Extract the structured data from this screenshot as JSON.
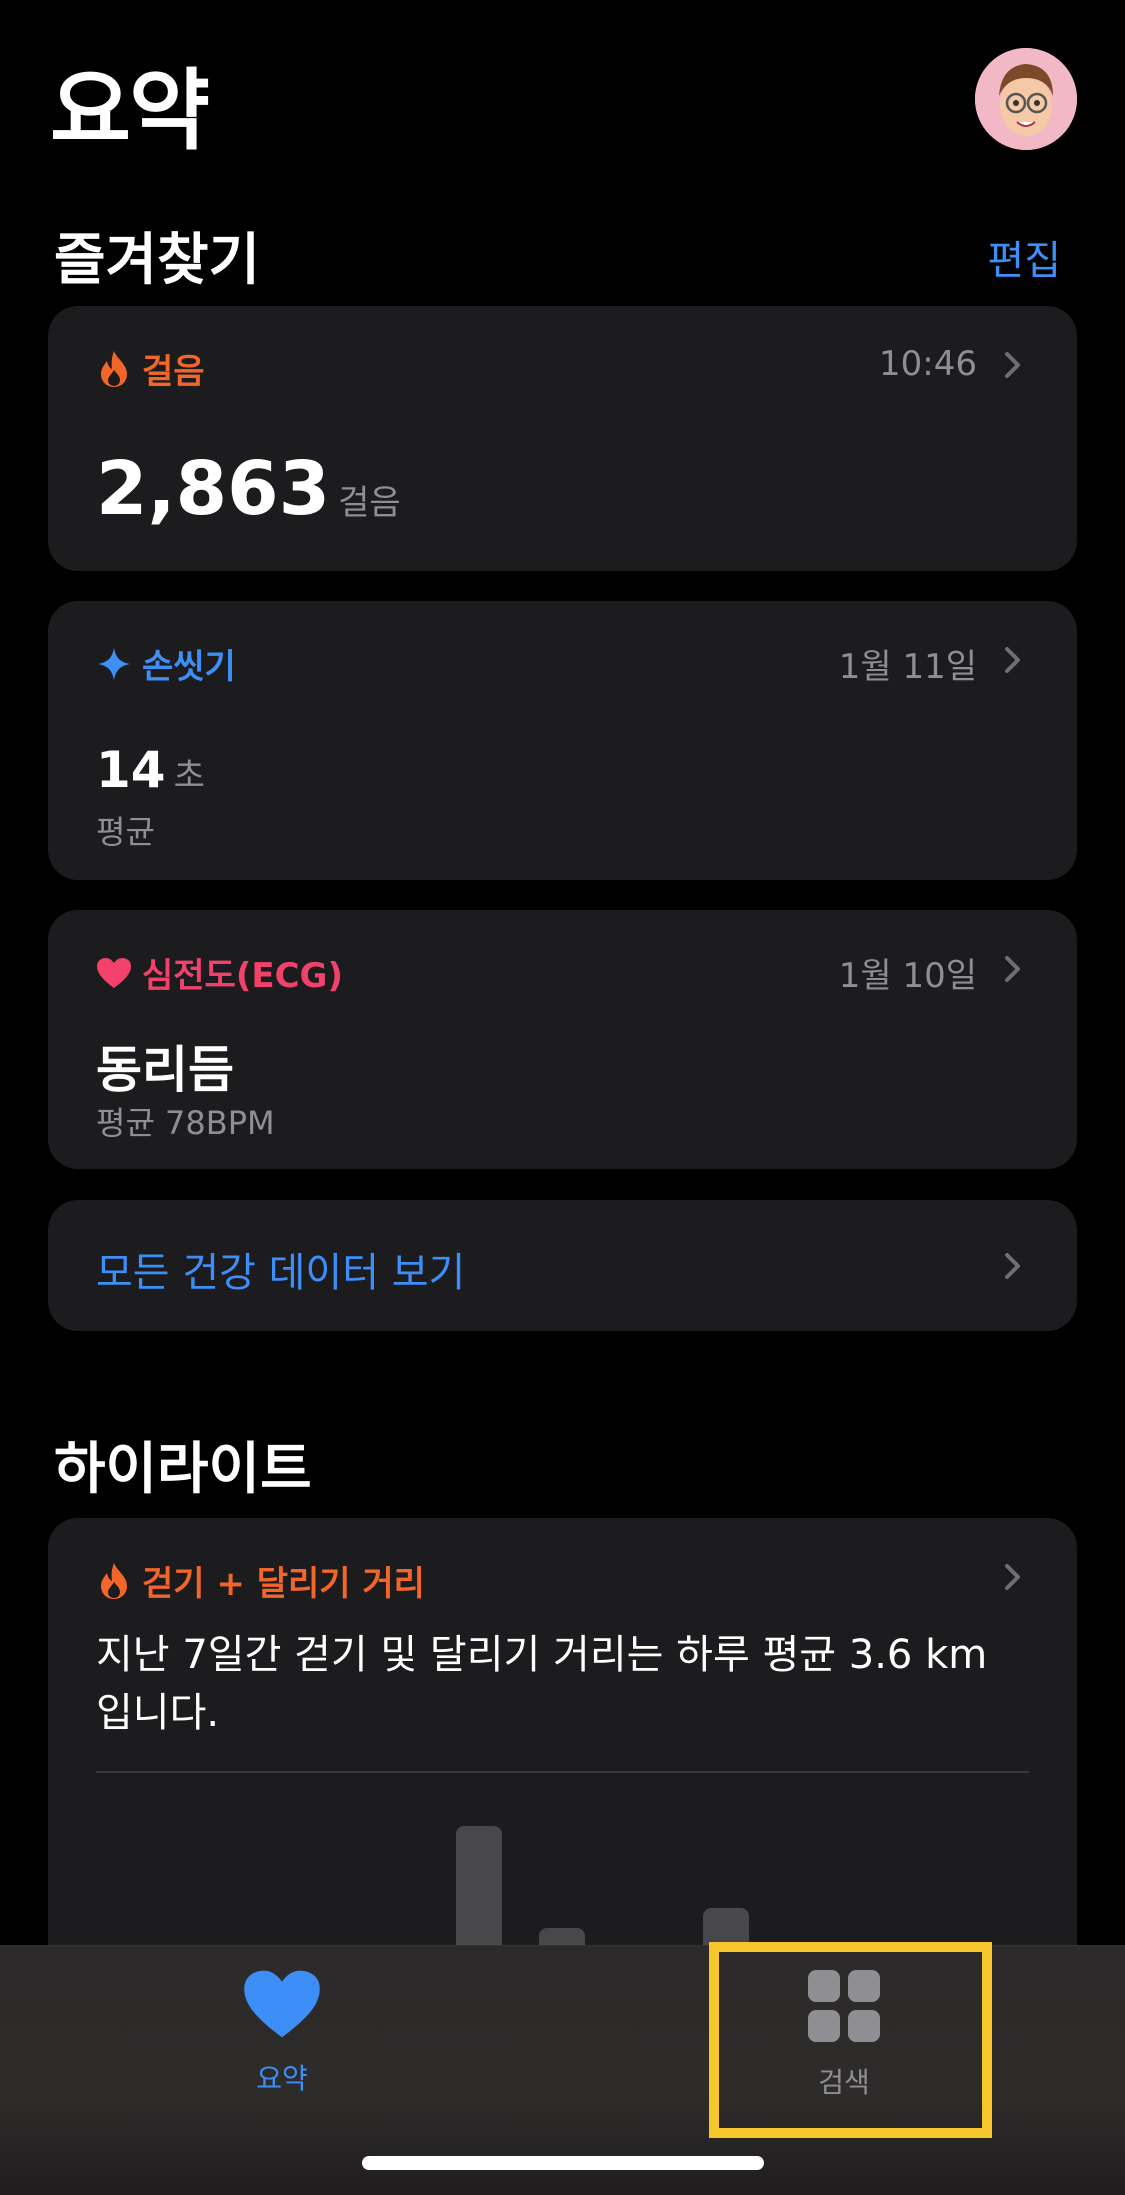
{
  "header": {
    "title": "요약"
  },
  "favorites": {
    "title": "즐겨찾기",
    "edit_label": "편집",
    "steps": {
      "label": "걸음",
      "time": "10:46",
      "value": "2,863",
      "unit": "걸음"
    },
    "handwash": {
      "label": "손씻기",
      "date": "1월 11일",
      "value": "14",
      "unit": "초",
      "sub": "평균"
    },
    "ecg": {
      "label": "심전도(ECG)",
      "date": "1월 10일",
      "value": "동리듬",
      "sub": "평균 78BPM"
    },
    "all_data_label": "모든 건강 데이터 보기"
  },
  "highlights": {
    "title": "하이라이트",
    "card": {
      "label": "걷기 + 달리기 거리",
      "text": "지난 7일간 걷기 및 달리기 거리는 하루 평균 3.6 km입니다."
    }
  },
  "tabbar": {
    "summary_label": "요약",
    "browse_label": "검색"
  },
  "colors": {
    "accent": "#3e8ef7",
    "orange": "#f2662a",
    "pink": "#f2426b",
    "highlight": "#f7c52c"
  },
  "icons": {
    "steps": "flame-icon",
    "handwash": "sparkle-icon",
    "ecg": "heart-icon",
    "summary_tab": "heart-icon",
    "browse_tab": "grid-icon"
  }
}
